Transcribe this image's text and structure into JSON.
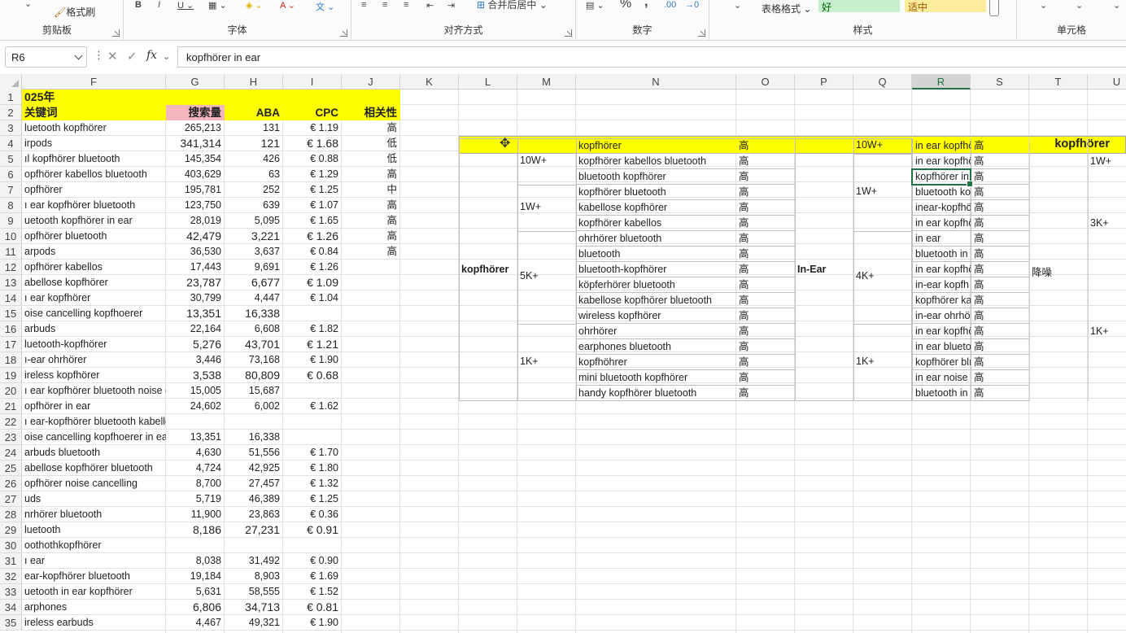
{
  "ribbon": {
    "clipboard": {
      "label": "剪贴板",
      "format_painter": "格式刷"
    },
    "font": {
      "label": "字体"
    },
    "alignment": {
      "label": "对齐方式",
      "merge_center": "合并后居中"
    },
    "number": {
      "label": "数字",
      "percent": "%",
      "comma": ","
    },
    "styles": {
      "label": "样式",
      "table_format": "表格格式",
      "good": "好",
      "neutral": "适中"
    },
    "cells": {
      "label": "单元格"
    }
  },
  "formula_bar": {
    "name_box": "R6",
    "formula": "kopfhörer in ear",
    "fx": "fx"
  },
  "columns": [
    "F",
    "G",
    "H",
    "I",
    "J",
    "K",
    "L",
    "M",
    "N",
    "O",
    "P",
    "Q",
    "R",
    "S",
    "T",
    "U"
  ],
  "selected_column": "R",
  "rows": [
    "1",
    "2",
    "3",
    "4",
    "5",
    "6",
    "7",
    "8",
    "9",
    "10",
    "11",
    "12",
    "13",
    "14",
    "15",
    "16",
    "17",
    "18",
    "19",
    "20",
    "21",
    "22",
    "23",
    "24",
    "25",
    "26",
    "27",
    "28",
    "29",
    "30",
    "31",
    "32",
    "33",
    "34",
    "35"
  ],
  "sheet": {
    "title": "025年",
    "headers": {
      "keyword": "关键词",
      "search": "搜索量",
      "aba": "ABA",
      "cpc": "CPC",
      "relevance": "相关性"
    },
    "table": [
      [
        "luetooth kopfhörer",
        "265,213",
        "131",
        "€ 1.19",
        "高"
      ],
      [
        "irpods",
        "341,314",
        "121",
        "€ 1.68",
        "低"
      ],
      [
        "ıl kopfhörer bluetooth",
        "145,354",
        "426",
        "€ 0.88",
        "低"
      ],
      [
        "opfhörer kabellos bluetooth",
        "403,629",
        "63",
        "€ 1.29",
        "高"
      ],
      [
        "opfhörer",
        "195,781",
        "252",
        "€ 1.25",
        "中"
      ],
      [
        "ı ear kopfhörer bluetooth",
        "123,750",
        "639",
        "€ 1.07",
        "高"
      ],
      [
        "uetooth kopfhörer in ear",
        "28,019",
        "5,095",
        "€ 1.65",
        "高"
      ],
      [
        "opfhörer bluetooth",
        "42,479",
        "3,221",
        "€ 1.26",
        "高"
      ],
      [
        "arpods",
        "36,530",
        "3,637",
        "€ 0.84",
        "高"
      ],
      [
        "opfhörer kabellos",
        "17,443",
        "9,691",
        "€ 1.26",
        ""
      ],
      [
        "abellose kopfhörer",
        "23,787",
        "6,677",
        "€ 1.09",
        ""
      ],
      [
        "ı ear kopfhörer",
        "30,799",
        "4,447",
        "€ 1.04",
        ""
      ],
      [
        "oise cancelling kopfhoerer",
        "13,351",
        "16,338",
        "",
        ""
      ],
      [
        "arbuds",
        "22,164",
        "6,608",
        "€ 1.82",
        ""
      ],
      [
        "luetooth-kopfhörer",
        "5,276",
        "43,701",
        "€ 1.21",
        ""
      ],
      [
        "ı-ear ohrhörer",
        "3,446",
        "73,168",
        "€ 1.90",
        ""
      ],
      [
        "ireless kopfhörer",
        "3,538",
        "80,809",
        "€ 0.68",
        ""
      ],
      [
        "ı ear kopfhörer bluetooth noise c",
        "15,005",
        "15,687",
        "",
        ""
      ],
      [
        "opfhörer in ear",
        "24,602",
        "6,002",
        "€ 1.62",
        ""
      ],
      [
        "ı ear-kopfhörer bluetooth kabellos",
        "",
        "",
        "",
        ""
      ],
      [
        "oise cancelling kopfhoerer in ea",
        "13,351",
        "16,338",
        "",
        ""
      ],
      [
        "arbuds bluetooth",
        "4,630",
        "51,556",
        "€ 1.70",
        ""
      ],
      [
        "abellose kopfhörer bluetooth",
        "4,724",
        "42,925",
        "€ 1.80",
        ""
      ],
      [
        "opfhörer noise cancelling",
        "8,700",
        "27,457",
        "€ 1.32",
        ""
      ],
      [
        "uds",
        "5,719",
        "46,389",
        "€ 1.25",
        ""
      ],
      [
        "nrhörer bluetooth",
        "11,900",
        "23,863",
        "€ 0.36",
        ""
      ],
      [
        "luetooth",
        "8,186",
        "27,231",
        "€ 0.91",
        ""
      ],
      [
        "oothothkopfhörer",
        "",
        "",
        "",
        ""
      ],
      [
        "ı ear",
        "8,038",
        "31,492",
        "€ 0.90",
        ""
      ],
      [
        "ear-kopfhörer bluetooth",
        "19,184",
        "8,903",
        "€ 1.69",
        ""
      ],
      [
        "uetooth in ear kopfhörer",
        "5,631",
        "58,555",
        "€ 1.52",
        ""
      ],
      [
        "arphones",
        "6,806",
        "34,713",
        "€ 0.81",
        ""
      ],
      [
        "ireless earbuds",
        "4,467",
        "49,321",
        "€ 1.90",
        ""
      ]
    ],
    "banner_title": "kopfhörer",
    "group_main": "kopfhörer",
    "group_inear": "In-Ear",
    "group_noise": "降噪",
    "m_labels": [
      "10W+",
      "1W+",
      "5K+",
      "1K+"
    ],
    "q_labels": [
      "10W+",
      "1W+",
      "4K+",
      "1K+"
    ],
    "u_labels": [
      "1W+",
      "3K+",
      "1K+"
    ],
    "n_keywords": [
      "kopfhörer",
      "kopfhörer kabellos bluetooth",
      "bluetooth kopfhörer",
      "kopfhörer bluetooth",
      "kabellose kopfhörer",
      "kopfhörer kabellos",
      "ohrhörer bluetooth",
      "bluetooth",
      "bluetooth-kopfhörer",
      "köpferhörer bluetooth",
      "kabellose kopfhörer bluetooth",
      "wireless kopfhörer",
      "ohrhörer",
      "earphones bluetooth",
      "kopfhöhrer",
      "mini bluetooth kopfhörer",
      "handy kopfhörer bluetooth"
    ],
    "r_keywords": [
      "in ear kopfhö",
      "in ear kopfhö",
      "kopfhörer in",
      "bluetooth ko",
      "inear-kopfhö",
      "in ear kopfhö",
      "in ear",
      "bluetooth in",
      "in ear kopfhö",
      "in-ear kopfh",
      "kopfhörer ka",
      "in-ear ohrhö",
      "in ear kopfhö",
      "in ear blueto",
      "kopfhörer blı",
      "in ear noise",
      "bluetooth in"
    ],
    "high": "高"
  }
}
